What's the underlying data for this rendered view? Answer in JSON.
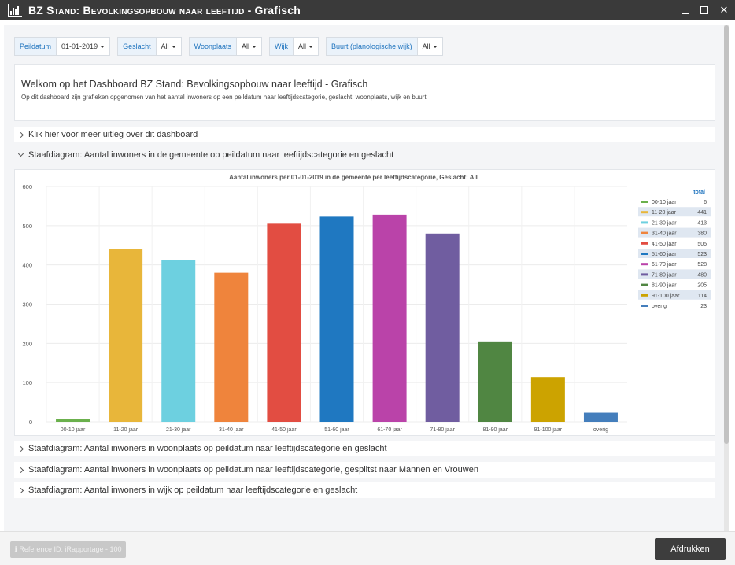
{
  "window": {
    "title_prefix": "BZ S",
    "title_sc": "tand: Bevolkingsopbouw naar leeftijd",
    "title_suffix": " - Grafisch",
    "minimize_icon": "minimize-icon",
    "maximize_icon": "maximize-icon",
    "close_label": "✕"
  },
  "filters": [
    {
      "label": "Peildatum",
      "value": "01-01-2019"
    },
    {
      "label": "Geslacht",
      "value": "All"
    },
    {
      "label": "Woonplaats",
      "value": "All"
    },
    {
      "label": "Wijk",
      "value": "All"
    },
    {
      "label": "Buurt (planologische wijk)",
      "value": "All"
    }
  ],
  "welcome": {
    "title": "Welkom op het Dashboard BZ Stand: Bevolkingsopbouw naar leeftijd - Grafisch",
    "text": "Op dit dashboard zijn grafieken opgenomen van het aantal inwoners op een peildatum naar leeftijdscategorie, geslacht, woonplaats, wijk en buurt."
  },
  "sections": {
    "uitleg": "Klik hier voor meer uitleg over dit dashboard",
    "gemeente": "Staafdiagram: Aantal inwoners in de gemeente op peildatum naar leeftijdscategorie en geslacht",
    "woonplaats": "Staafdiagram: Aantal inwoners in woonplaats op peildatum naar leeftijdscategorie en geslacht",
    "woonplaats_mv": "Staafdiagram: Aantal inwoners in woonplaats op peildatum naar leeftijdscategorie, gesplitst naar Mannen en Vrouwen",
    "wijk": "Staafdiagram: Aantal inwoners in wijk op peildatum naar leeftijdscategorie en geslacht"
  },
  "chart_data": {
    "type": "bar",
    "title": "Aantal inwoners per 01-01-2019 in de gemeente per leeftijdscategorie, Geslacht: All",
    "categories": [
      "00-10 jaar",
      "11-20 jaar",
      "21-30 jaar",
      "31-40 jaar",
      "41-50 jaar",
      "51-60 jaar",
      "61-70 jaar",
      "71-80 jaar",
      "81-90 jaar",
      "91-100 jaar",
      "overig"
    ],
    "values": [
      6,
      441,
      413,
      380,
      505,
      523,
      528,
      480,
      205,
      114,
      23
    ],
    "colors": [
      "#6ab04c",
      "#e8b63a",
      "#6dd0e0",
      "#ef843c",
      "#e24d42",
      "#1f78c1",
      "#ba43a9",
      "#705da0",
      "#508642",
      "#cca300",
      "#447ebc"
    ],
    "legend_entries": [
      "00-10 jaar",
      "11-20 jaar",
      "21-30 jaar",
      "31-40 jaar",
      "41-50 jaar",
      "51-60 jaar",
      "61-70 jaar",
      "71-80 jaar",
      "81-90 jaar",
      "91-100 jaar",
      "overig"
    ],
    "legend_header": "total",
    "legend_placement": "right",
    "yticks": [
      0,
      100,
      200,
      300,
      400,
      500,
      600
    ],
    "ylim": [
      0,
      600
    ],
    "grid": true
  },
  "footer": {
    "reference": "ℹ Reference ID: iRapportage - 100",
    "print": "Afdrukken"
  }
}
